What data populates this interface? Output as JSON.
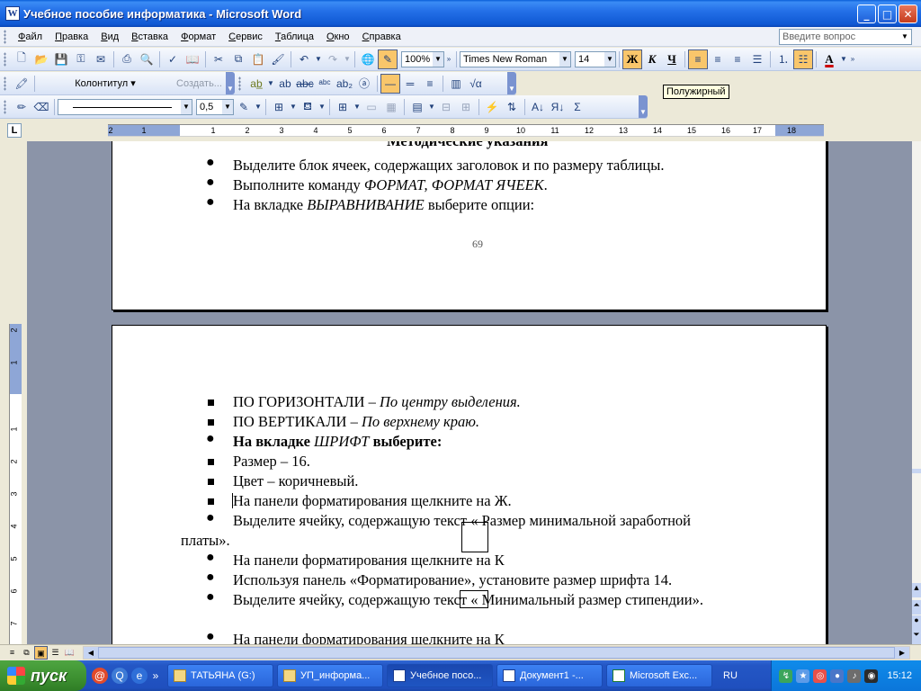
{
  "window": {
    "title": "Учебное пособие информатика - Microsoft Word",
    "minimize": "_",
    "maximize": "□",
    "close": "✕"
  },
  "menu": {
    "items": [
      "Файл",
      "Правка",
      "Вид",
      "Вставка",
      "Формат",
      "Сервис",
      "Таблица",
      "Окно",
      "Справка"
    ],
    "help_placeholder": "Введите вопрос"
  },
  "toolbar_standard": {
    "zoom": "100%",
    "font": "Times New Roman",
    "size": "14",
    "bold": "Ж",
    "italic": "К",
    "underline": "Ч",
    "font_color_letter": "А"
  },
  "toolbar_header": {
    "header_footer": "Колонтитул ▾",
    "create": "Создать..."
  },
  "toolbar_tables": {
    "line_weight": "0,5"
  },
  "tooltip": "Полужирный",
  "ruler": {
    "corner": "L",
    "numbers": [
      "2",
      "1",
      "1",
      "2",
      "3",
      "4",
      "5",
      "6",
      "7",
      "8",
      "9",
      "10",
      "11",
      "12",
      "13",
      "14",
      "15",
      "16",
      "17",
      "18"
    ],
    "vnumbers": [
      "2",
      "1",
      "1",
      "2",
      "3",
      "4",
      "5",
      "6",
      "7"
    ]
  },
  "document": {
    "page1": {
      "heading": "Методические указания",
      "items": [
        {
          "text": "Выделите блок ячеек, содержащих заголовок и  по размеру таблицы."
        },
        {
          "pre": "Выполните команду ",
          "em": "ФОРМАТ, ФОРМАТ ЯЧЕЕК",
          "post": "."
        },
        {
          "pre": "На вкладке ",
          "em": "ВЫРАВНИВАНИЕ",
          "post": " выберите опции:"
        }
      ],
      "page_number": "69"
    },
    "page2": {
      "lines": [
        {
          "bullet": "square",
          "pre": "ПО ГОРИЗОНТАЛИ – ",
          "em": "По центру выделения."
        },
        {
          "bullet": "square",
          "pre": "ПО ВЕРТИКАЛИ – ",
          "em": "По верхнему краю."
        },
        {
          "bullet": "dot",
          "pre": "На вкладке ",
          "em": "ШРИФТ",
          "post": " выберите:",
          "bold": true
        },
        {
          "bullet": "square",
          "pre": "Размер – 16."
        },
        {
          "bullet": "square",
          "pre": "Цвет – коричневый."
        },
        {
          "bullet": "square",
          "pre": "На панели форматирования щелкните на     Ж."
        },
        {
          "bullet": "dot",
          "pre": "Выделите ячейку, содержащую текст « Размер минимальной заработной"
        },
        {
          "bullet": "none",
          "pre": "платы»."
        },
        {
          "bullet": "dot",
          "pre": "На панели форматирования щелкните на     К"
        },
        {
          "bullet": "dot",
          "pre": "Используя панель «Форматирование», установите размер шрифта 14."
        },
        {
          "bullet": "dot",
          "pre": "Выделите ячейку, содержащую текст « Минимальный размер стипендии»."
        },
        {
          "bullet": "dot",
          "pre": "На панели форматирования щелкните на     К"
        }
      ]
    }
  },
  "taskbar": {
    "start": "пуск",
    "tasks": [
      {
        "label": "ТАТЬЯНА (G:)",
        "icon": "folder"
      },
      {
        "label": "УП_информа...",
        "icon": "folder"
      },
      {
        "label": "Учебное посо...",
        "icon": "word",
        "active": true
      },
      {
        "label": "Документ1 -...",
        "icon": "word"
      },
      {
        "label": "Microsoft Exc...",
        "icon": "excel"
      }
    ],
    "language": "RU",
    "clock": "15:12"
  },
  "colors": {
    "accent": "#2470E8",
    "selected_button": "#F9C66B",
    "taskbar": "#2457C5",
    "start_green": "#3C8F30"
  }
}
